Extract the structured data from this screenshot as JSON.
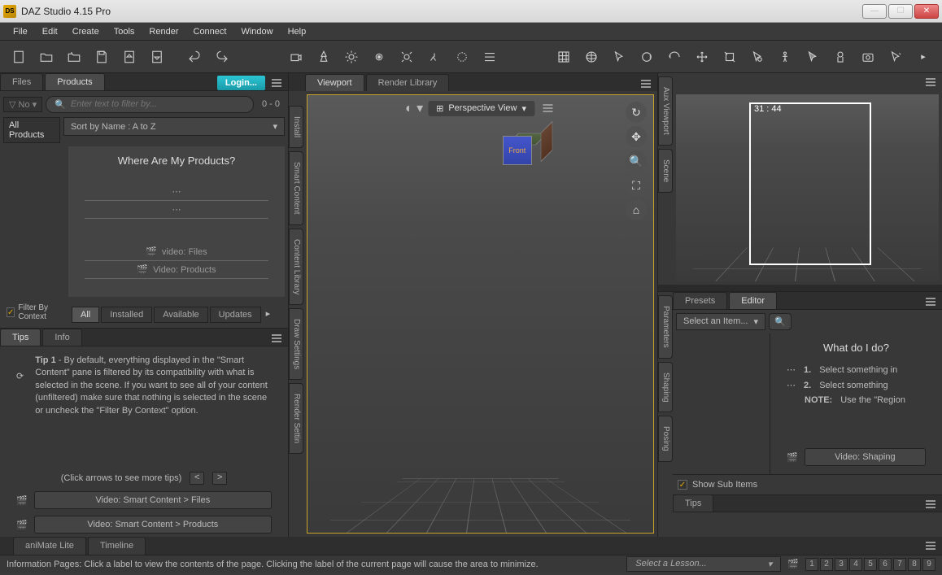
{
  "window": {
    "title": "DAZ Studio 4.15 Pro"
  },
  "menubar": [
    "File",
    "Edit",
    "Create",
    "Tools",
    "Render",
    "Connect",
    "Window",
    "Help"
  ],
  "leftPanel": {
    "tabs": {
      "files": "Files",
      "products": "Products"
    },
    "login": "Login...",
    "filterPlaceholder": "Enter text to filter by...",
    "count": "0 - 0",
    "allProducts": "All Products",
    "sortBy": "Sort by Name : A to Z",
    "productsHeading": "Where Are My Products?",
    "videoFiles": "video: Files",
    "videoProducts": "Video: Products",
    "filterByContext": "Filter By Context",
    "filterTabs": [
      "All",
      "Installed",
      "Available",
      "Updates"
    ]
  },
  "tipsPanel": {
    "tabs": {
      "tips": "Tips",
      "info": "Info"
    },
    "tipLabel": "Tip 1",
    "tipBody": " - By default, everything displayed in the \"Smart Content\" pane is filtered by its compatibility with what is selected in the scene. If you want to see all of your content (unfiltered) make sure that nothing is selected in the scene or uncheck the \"Filter By Context\" option.",
    "navHint": "(Click arrows to see more tips)",
    "prev": "<",
    "next": ">",
    "video1": "Video: Smart Content > Files",
    "video2": "Video: Smart Content > Products"
  },
  "centerPanel": {
    "tabs": {
      "viewport": "Viewport",
      "renderLibrary": "Render Library"
    },
    "viewMode": "Perspective View",
    "cubeFace": "Front",
    "sideTabs": [
      "Install",
      "Smart Content",
      "Content Library",
      "Draw Settings",
      "Render Settin"
    ]
  },
  "rightPanel": {
    "auxLabel": "31 : 44",
    "sideTabs": [
      "Aux Viewport",
      "Scene",
      "Parameters",
      "Shaping",
      "Posing"
    ],
    "editorTabs": {
      "presets": "Presets",
      "editor": "Editor"
    },
    "selectItem": "Select an Item...",
    "helpTitle": "What do I do?",
    "helpItems": [
      {
        "num": "1.",
        "text": "Select something in"
      },
      {
        "num": "2.",
        "text": "Select something"
      }
    ],
    "helpNote": "NOTE:",
    "helpNoteText": " Use the \"Region",
    "videoShaping": "Video: Shaping",
    "showSub": "Show Sub Items",
    "tipsTab": "Tips"
  },
  "bottomTabs": {
    "animate": "aniMate Lite",
    "timeline": "Timeline"
  },
  "statusBar": {
    "text": "Information Pages: Click a label to view the contents of the page. Clicking the label of the current page will cause the area to minimize.",
    "lesson": "Select a Lesson...",
    "pages": [
      "1",
      "2",
      "3",
      "4",
      "5",
      "6",
      "7",
      "8",
      "9"
    ]
  }
}
